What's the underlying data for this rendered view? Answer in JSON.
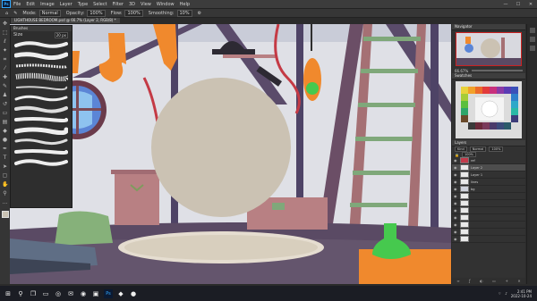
{
  "menu": {
    "logo": "Ps",
    "items": [
      "File",
      "Edit",
      "Image",
      "Layer",
      "Type",
      "Select",
      "Filter",
      "3D",
      "View",
      "Window",
      "Help"
    ],
    "window_buttons": [
      "—",
      "☐",
      "✕"
    ]
  },
  "options": {
    "mode_label": "Mode:",
    "mode_value": "Normal",
    "opacity_label": "Opacity:",
    "opacity_value": "100%",
    "flow_label": "Flow:",
    "flow_value": "100%",
    "smoothing_label": "Smoothing:",
    "smoothing_value": "10%"
  },
  "document": {
    "tab_title": "LIGHTHOUSE BEDROOM.psd @ 66.7% (Layer 2, RGB/8) *"
  },
  "brushes_panel": {
    "title": "Brushes",
    "size_label": "Size",
    "size_value": "20 px"
  },
  "navigator": {
    "tab": "Navigator",
    "zoom": "66.67%"
  },
  "swatches": {
    "tab": "Swatches"
  },
  "layers": {
    "tab": "Layers",
    "kind": "Kind",
    "blend": "Normal",
    "opacity": "100%",
    "fill": "100%",
    "items": [
      {
        "name": "ref",
        "selected": false
      },
      {
        "name": "Layer 2",
        "selected": true
      },
      {
        "name": "Layer 1",
        "selected": false
      },
      {
        "name": "lines",
        "selected": false
      },
      {
        "name": "bg",
        "selected": false
      }
    ]
  },
  "status": {
    "zoom": "66.67%"
  },
  "taskbar": {
    "time": "2:41 PM",
    "date": "2022-10-24"
  },
  "colors": {
    "accent": "#31a8ff",
    "canvas_wall": "#dfe0e6",
    "floor": "#5a4a64",
    "circle": "#cbc2b3",
    "orange": "#f0892d",
    "green_bottle": "#46c94e",
    "pink_blocks": "#b88083",
    "ladder": "#a57074"
  }
}
